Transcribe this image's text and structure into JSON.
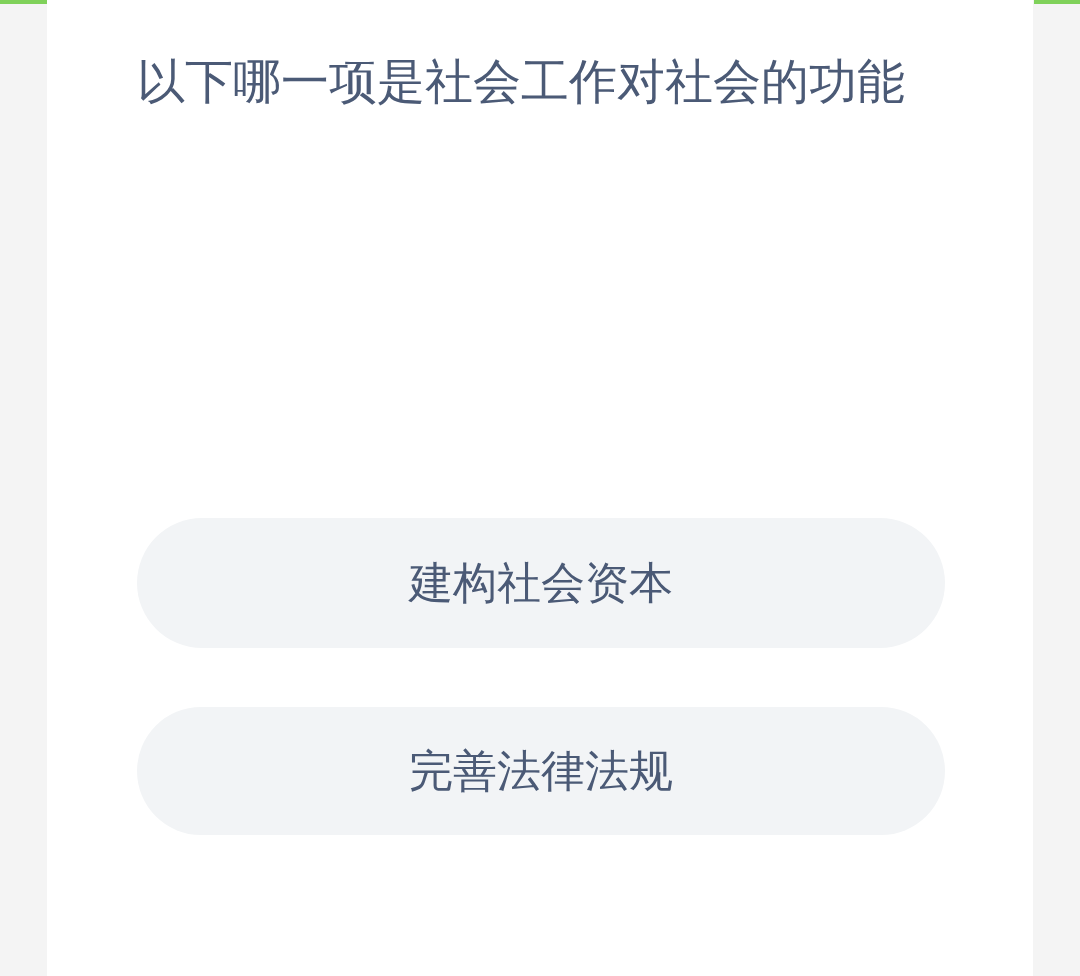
{
  "question": "以下哪一项是社会工作对社会的功能",
  "options": [
    {
      "label": "建构社会资本"
    },
    {
      "label": "完善法律法规"
    }
  ]
}
